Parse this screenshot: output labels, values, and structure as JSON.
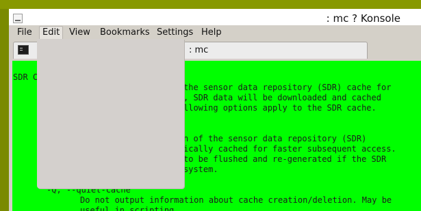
{
  "window": {
    "title": ": mc ? Konsole"
  },
  "menubar": {
    "items": [
      "File",
      "Edit",
      "View",
      "Bookmarks",
      "Settings",
      "Help"
    ]
  },
  "tab": {
    "label": ": mc"
  },
  "terminal": {
    "lines": [
      "SDR C",
      "the sensor data repository (SDR) cache for",
      ", SDR data will be downloaded and cached",
      "llowing options apply to the SDR cache.",
      "n of the sensor data repository (SDR)",
      "ically cached for faster subsequent access.",
      "to be flushed and re-generated if the SDR",
      "system.",
      "-Q, --quiet-cache",
      "Do not output information about cache creation/deletion. May be",
      "useful in scripting."
    ]
  }
}
